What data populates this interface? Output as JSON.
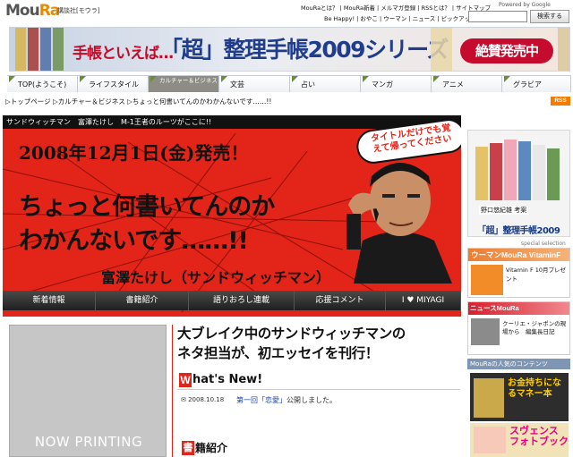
{
  "header": {
    "logo": "MouRa",
    "publisher": "講談社[モウラ]",
    "links_row1": "MouRaとは？ | MouRa新着 | メルマガ登録 | RSSとは？ | サイトマップ",
    "links_row2": "Be Happy! | おやこ | ウーマン | ニュース | ピックアップ",
    "powered": "Powered by Google",
    "search_placeholder": "",
    "search_button": "検索する"
  },
  "banner": {
    "lead": "手帳といえば…",
    "title": "「超」整理手帳2009シリーズ",
    "badge": "絶賛発売中"
  },
  "nav": {
    "tabs": [
      {
        "label": "TOP(ようこそ)",
        "width": 79
      },
      {
        "label": "ライフスタイル",
        "width": 79
      },
      {
        "label": "カルチャー＆ビジネス",
        "width": 79,
        "active": true
      },
      {
        "label": "文芸",
        "width": 79
      },
      {
        "label": "占い",
        "width": 79
      },
      {
        "label": "マンガ",
        "width": 79
      },
      {
        "label": "アニメ",
        "width": 79
      },
      {
        "label": "グラビア",
        "width": 77
      }
    ]
  },
  "breadcrumb": "▷トップページ ▷カルチャー＆ビジネス ▷ちょっと何書いてんのかわかんないです……!!",
  "rss": "RSS",
  "hero": {
    "strap": "サンドウィッチマン　富澤たけし　M-1王者のルーツがここに!!",
    "release": "2008年12月1日(金)発売！",
    "speech": "タイトルだけでも覚えて帰ってください",
    "catch1": "ちょっと何書いてんのか",
    "catch2": "わかんないです……!!",
    "author": "富澤たけし（サンドウィッチマン）"
  },
  "subnav": [
    "新着情報",
    "書籍紹介",
    "語りおろし連載",
    "応援コメント",
    "I ♥ MIYAGI"
  ],
  "right": {
    "book_author": "野口悠紀雄 考案",
    "book_title": "「超」整理手帳2009",
    "special": "special selection",
    "vitamin_head": "ウーマンMouRa VitaminF",
    "vitamin_text": "Vitamin F 10月プレゼント",
    "news_head": "ニュースMouRa",
    "news_text": "クーリエ・ジャポンの現場から　編集長日記",
    "pop_head": "MouRaの人気のコンテンツ",
    "pop1": "お金持ちになるマネー本",
    "pop2": "スヴェンス フォトブック"
  },
  "content": {
    "nowprinting": "NOW PRINTING",
    "headline1": "大ブレイク中のサンドウィッチマンの",
    "headline2": "ネタ担当が、初エッセイを刊行！",
    "whatsnew": "hat's New!",
    "whatsnew_w": "W",
    "news_date": "2008.10.18",
    "news_link": "第一回「恋愛」",
    "news_suffix": "公開しました。",
    "books_w": "書",
    "books": "籍紹介"
  },
  "colors": {
    "accent": "#e32418",
    "brand": "#1f3d8c"
  }
}
